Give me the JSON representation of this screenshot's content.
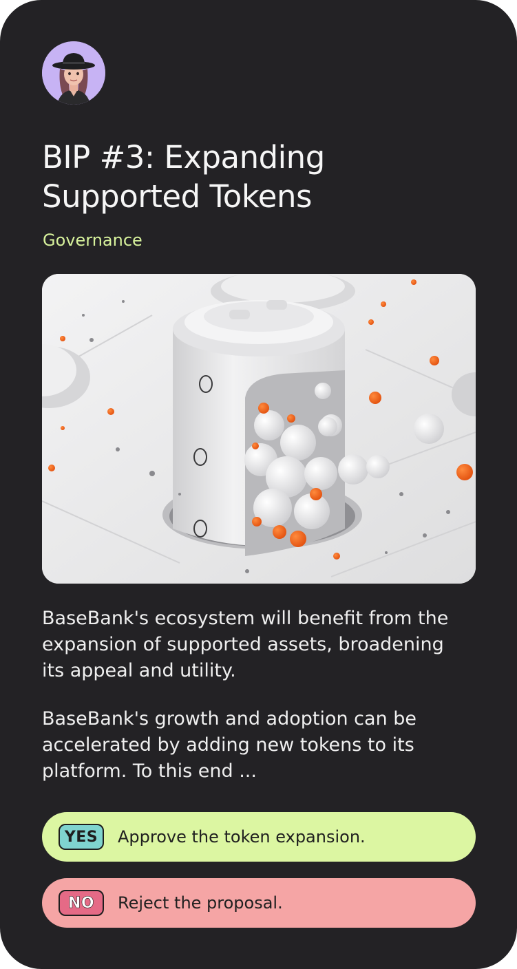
{
  "proposal": {
    "title": "BIP #3: Expanding Supported Tokens",
    "category": "Governance",
    "description": [
      "BaseBank's ecosystem will benefit from the expansion of supported assets, broadening its appeal and utility.",
      "BaseBank's growth and adoption can be accelerated by adding new tokens to its platform. To this end ..."
    ]
  },
  "options": [
    {
      "badge": "YES",
      "label": "Approve the token expansion."
    },
    {
      "badge": "NO",
      "label": "Reject the proposal."
    }
  ],
  "icons": {
    "avatar": "avatar-icon",
    "hero": "token-cylinder-illustration"
  },
  "colors": {
    "card_background": "#232225",
    "category": "#d7f29c",
    "yes_button": "#dcf6a2",
    "no_button": "#f5a5a5",
    "yes_badge": "#7fd4cf",
    "no_badge": "#e56a86",
    "accent_orange": "#f0631c"
  }
}
